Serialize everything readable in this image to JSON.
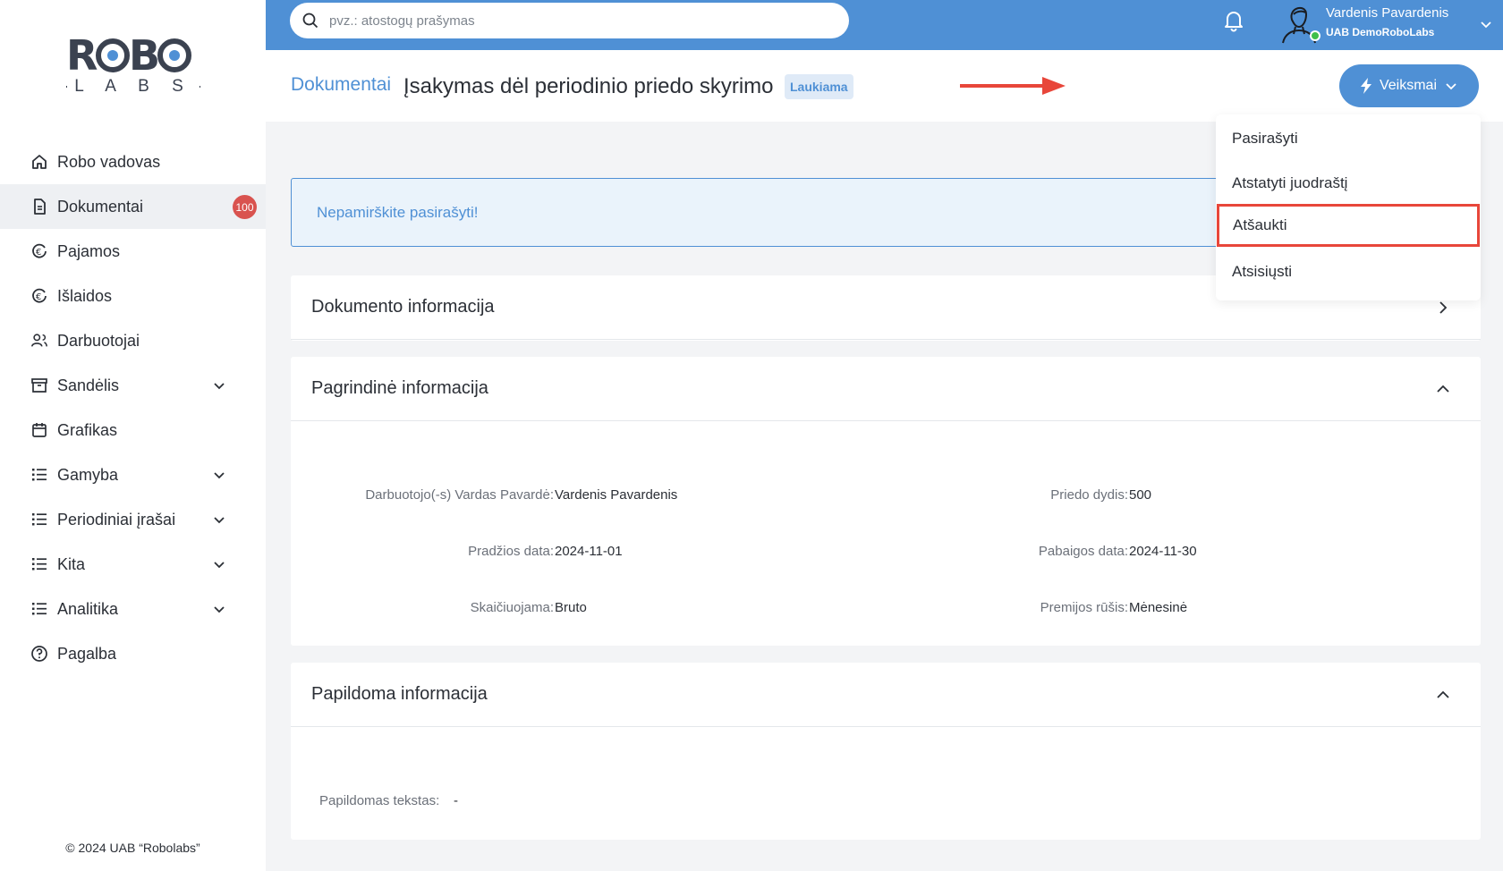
{
  "brand": {
    "logo_top": "ROBO",
    "logo_bottom": "LABS"
  },
  "sidebar": {
    "items": [
      {
        "label": "Robo vadovas",
        "icon": "home-icon"
      },
      {
        "label": "Dokumentai",
        "icon": "document-icon",
        "count": "100",
        "active": true
      },
      {
        "label": "Pajamos",
        "icon": "income-icon"
      },
      {
        "label": "Išlaidos",
        "icon": "expenses-icon"
      },
      {
        "label": "Darbuotojai",
        "icon": "users-icon"
      },
      {
        "label": "Sandėlis",
        "icon": "warehouse-icon",
        "expandable": true
      },
      {
        "label": "Grafikas",
        "icon": "calendar-icon"
      },
      {
        "label": "Gamyba",
        "icon": "list-icon",
        "expandable": true
      },
      {
        "label": "Periodiniai įrašai",
        "icon": "list-icon",
        "expandable": true
      },
      {
        "label": "Kita",
        "icon": "list-icon",
        "expandable": true
      },
      {
        "label": "Analitika",
        "icon": "list-icon",
        "expandable": true
      },
      {
        "label": "Pagalba",
        "icon": "help-icon"
      }
    ],
    "copyright": "© 2024 UAB “Robolabs”"
  },
  "topbar": {
    "search_placeholder": "pvz.: atostogų prašymas",
    "user_name": "Vardenis Pavardenis",
    "user_company": "UAB DemoRoboLabs"
  },
  "header": {
    "breadcrumb": "Dokumentai",
    "title": "Įsakymas dėl periodinio priedo skyrimo",
    "status": "Laukiama",
    "actions_label": "Veiksmai"
  },
  "actions_menu": {
    "items": [
      "Pasirašyti",
      "Atstatyti juodraštį",
      "Atšaukti",
      "Atsisiųsti"
    ],
    "highlighted": "Atšaukti"
  },
  "alert": {
    "text": "Nepamirškite pasirašyti!"
  },
  "sections": {
    "doc_info": {
      "title": "Dokumento informacija"
    },
    "main_info": {
      "title": "Pagrindinė informacija",
      "fields": [
        {
          "label": "Darbuotojo(-s) Vardas Pavardė:",
          "value": "Vardenis Pavardenis"
        },
        {
          "label": "Priedo dydis:",
          "value": "500"
        },
        {
          "label": "Pradžios data:",
          "value": "2024-11-01"
        },
        {
          "label": "Pabaigos data:",
          "value": "2024-11-30"
        },
        {
          "label": "Skaičiuojama:",
          "value": "Bruto"
        },
        {
          "label": "Premijos rūšis:",
          "value": "Mėnesinė"
        }
      ]
    },
    "extra_info": {
      "title": "Papildoma informacija",
      "fields": [
        {
          "label": "Papildomas tekstas:",
          "value": "-"
        }
      ]
    }
  },
  "colors": {
    "primary": "#4f90d5",
    "danger": "#d9534f",
    "highlight": "#e8463a"
  }
}
